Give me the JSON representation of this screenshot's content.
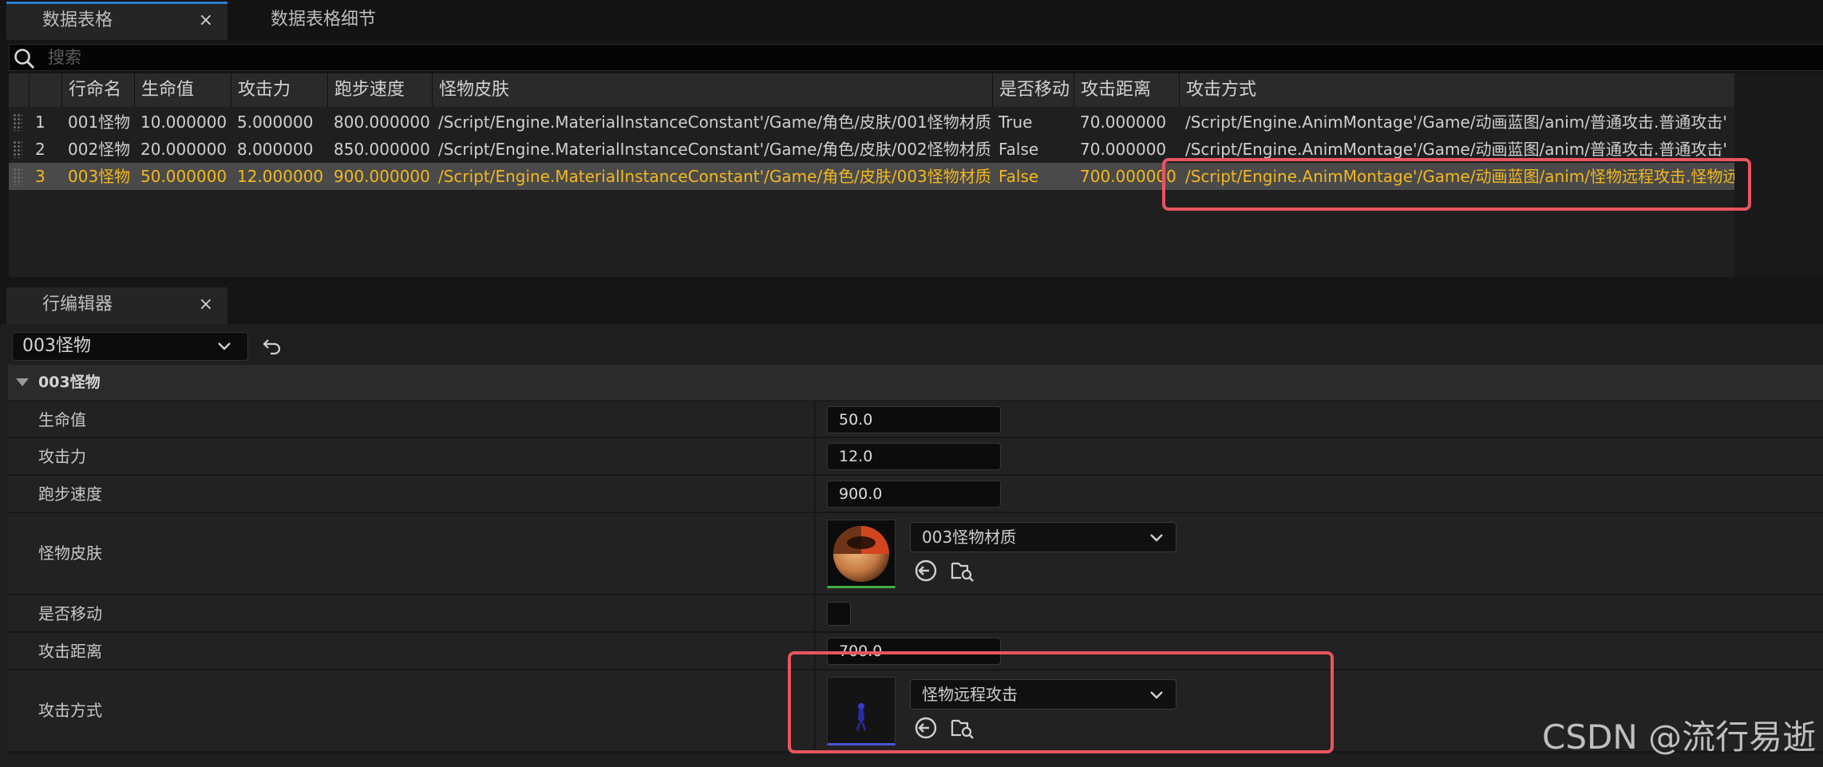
{
  "tabs": [
    {
      "label": "数据表格",
      "active": true,
      "close": "×"
    },
    {
      "label": "数据表格细节",
      "active": false
    }
  ],
  "search": {
    "placeholder": "搜索"
  },
  "table": {
    "columns": [
      "",
      "行命名",
      "生命值",
      "攻击力",
      "跑步速度",
      "怪物皮肤",
      "是否移动",
      "攻击距离",
      "攻击方式"
    ],
    "rows": [
      {
        "index": "1",
        "name": "001怪物",
        "hp": "10.000000",
        "attack": "5.000000",
        "speed": "800.000000",
        "skin": "/Script/Engine.MaterialInstanceConstant'/Game/角色/皮肤/001怪物材质",
        "move": "True",
        "range": "70.000000",
        "attack_mode": "/Script/Engine.AnimMontage'/Game/动画蓝图/anim/普通攻击.普通攻击'",
        "selected": false
      },
      {
        "index": "2",
        "name": "002怪物",
        "hp": "20.000000",
        "attack": "8.000000",
        "speed": "850.000000",
        "skin": "/Script/Engine.MaterialInstanceConstant'/Game/角色/皮肤/002怪物材质",
        "move": "False",
        "range": "70.000000",
        "attack_mode": "/Script/Engine.AnimMontage'/Game/动画蓝图/anim/普通攻击.普通攻击'",
        "selected": false
      },
      {
        "index": "3",
        "name": "003怪物",
        "hp": "50.000000",
        "attack": "12.000000",
        "speed": "900.000000",
        "skin": "/Script/Engine.MaterialInstanceConstant'/Game/角色/皮肤/003怪物材质",
        "move": "False",
        "range": "700.000000",
        "attack_mode": "/Script/Engine.AnimMontage'/Game/动画蓝图/anim/怪物远程攻击.怪物远程攻击'",
        "selected": true
      }
    ]
  },
  "editor": {
    "tab_label": "行编辑器",
    "tab_close": "×",
    "row_select": "003怪物",
    "section_title": "003怪物",
    "fields": {
      "hp": {
        "label": "生命值",
        "value": "50.0"
      },
      "attack": {
        "label": "攻击力",
        "value": "12.0"
      },
      "speed": {
        "label": "跑步速度",
        "value": "900.0"
      },
      "skin": {
        "label": "怪物皮肤",
        "asset": "003怪物材质"
      },
      "move": {
        "label": "是否移动",
        "checked": false
      },
      "range": {
        "label": "攻击距离",
        "value": "700.0"
      },
      "attack_mode": {
        "label": "攻击方式",
        "asset": "怪物远程攻击"
      }
    }
  },
  "watermark": "CSDN @流行易逝",
  "colors": {
    "accent_blue": "#2a7fd4",
    "selected_text": "#f2b820",
    "highlight_box": "#e8555f"
  }
}
